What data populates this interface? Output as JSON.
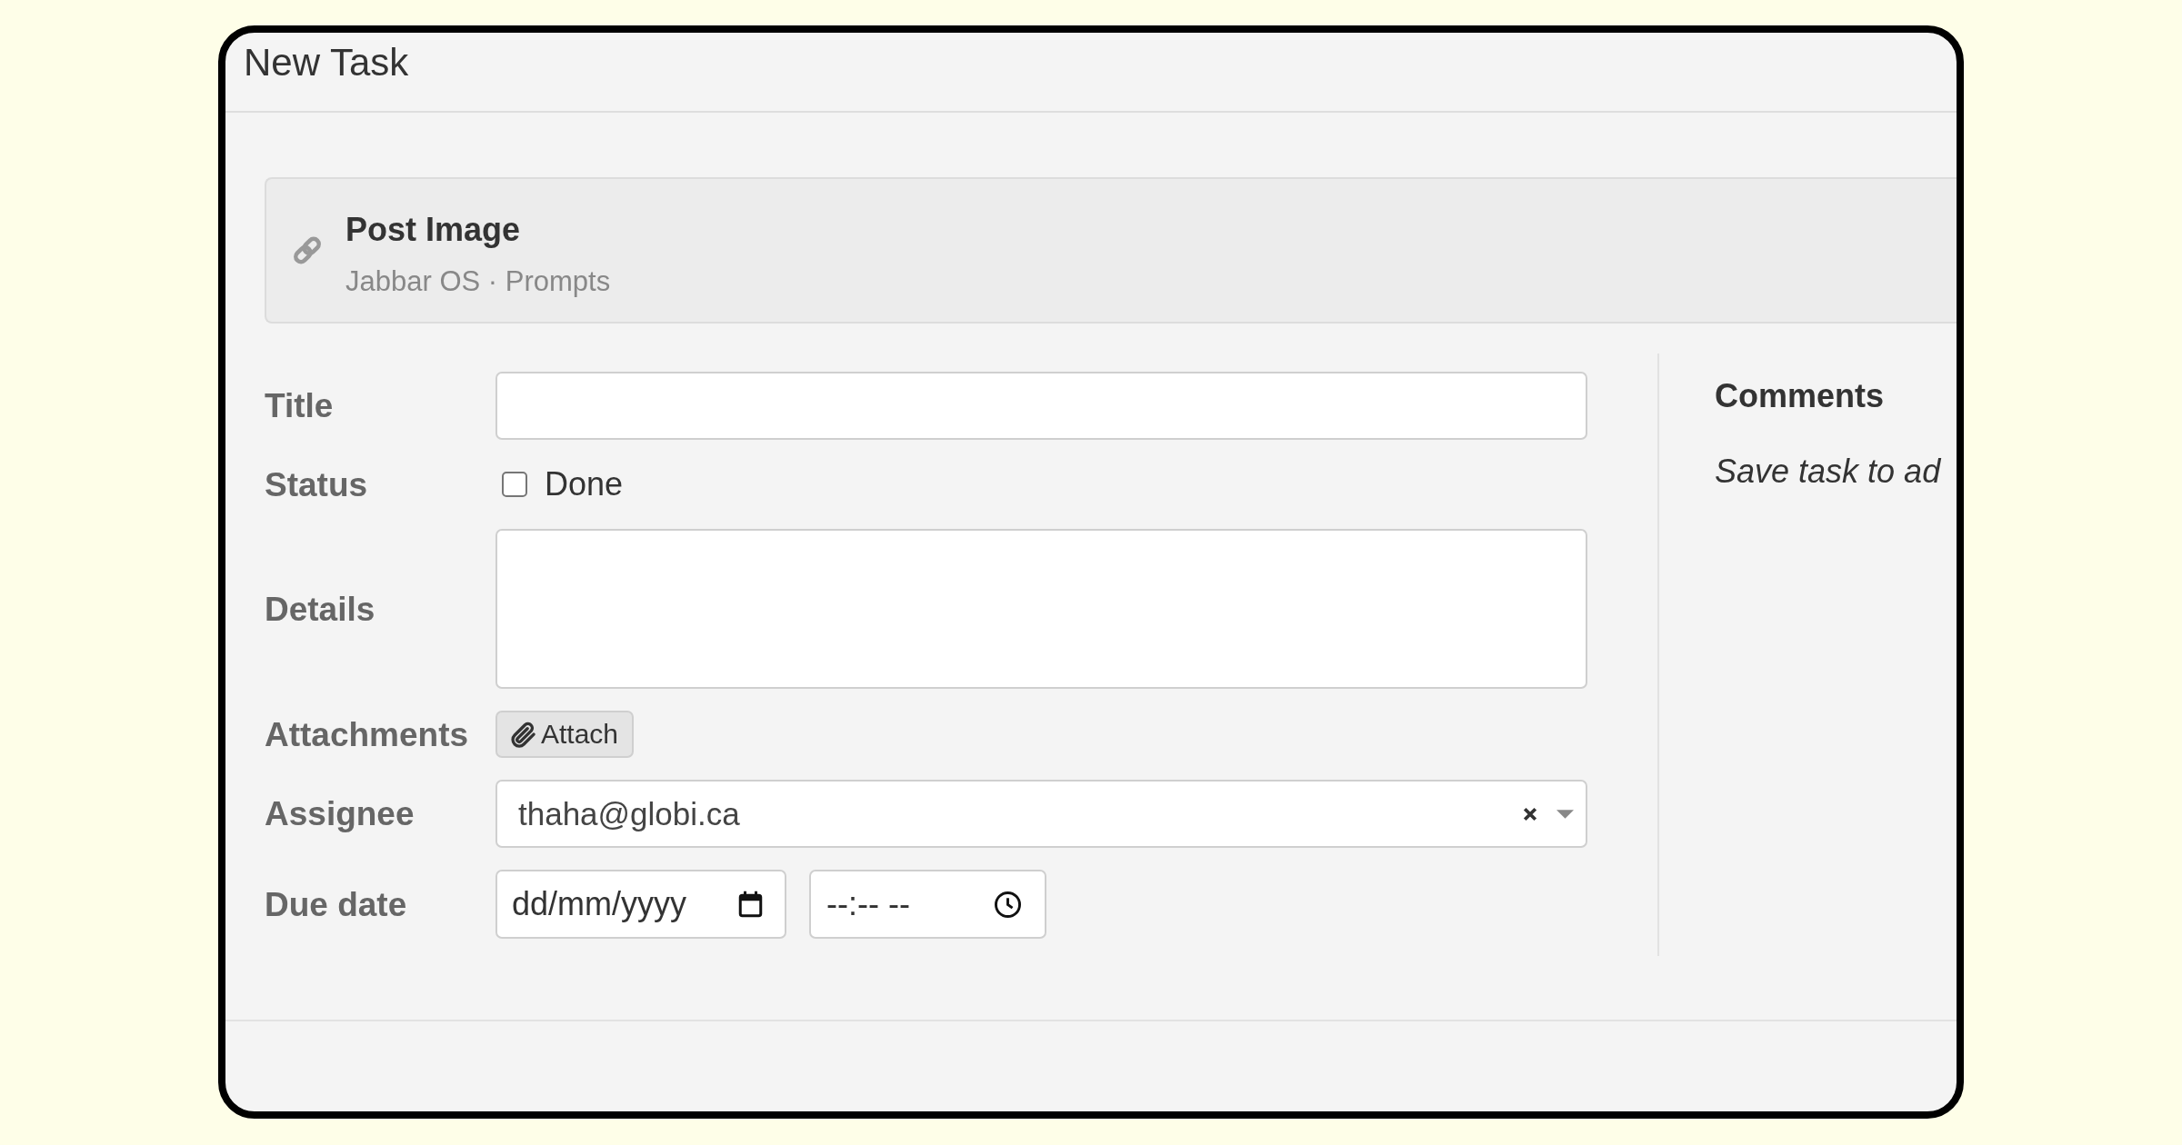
{
  "window": {
    "title": "New Task"
  },
  "linked_item": {
    "title": "Post Image",
    "subtitle": "Jabbar OS · Prompts"
  },
  "form": {
    "fields": [
      {
        "kind": "text",
        "label": "Title"
      },
      {
        "kind": "checkbox",
        "label": "Status",
        "option": "Done",
        "checked": false
      },
      {
        "kind": "textarea",
        "label": "Details"
      },
      {
        "kind": "attach",
        "label": "Attachments",
        "button": "Attach"
      },
      {
        "kind": "select",
        "label": "Assignee",
        "value": "thaha@globi.ca"
      },
      {
        "kind": "datetime",
        "label": "Due date",
        "date_placeholder": "dd/mm/yyyy",
        "time_placeholder": "--:-- --"
      }
    ]
  },
  "comments": {
    "heading": "Comments",
    "note": "Save task to ad"
  }
}
